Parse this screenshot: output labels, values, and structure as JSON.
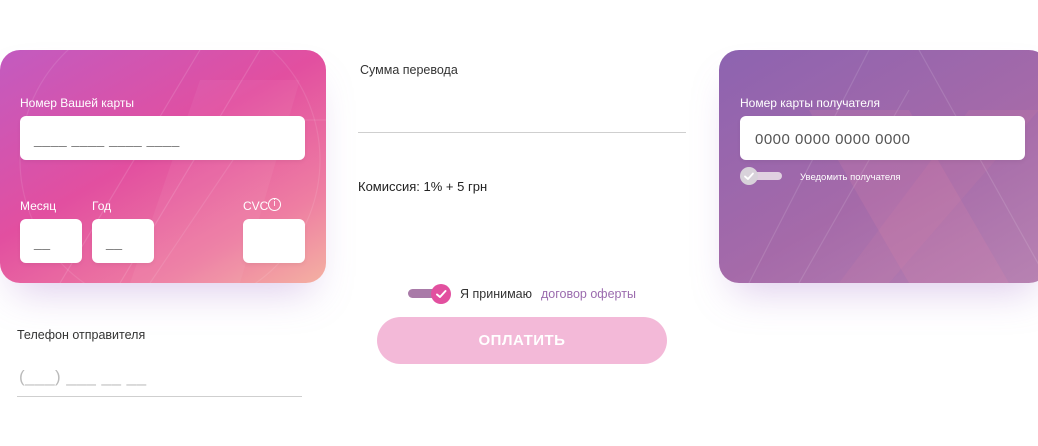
{
  "sender_card": {
    "number_label": "Номер Вашей карты",
    "number_placeholder": "____ ____ ____ ____",
    "month_label": "Месяц",
    "month_placeholder": "__",
    "year_label": "Год",
    "year_placeholder": "__",
    "cvc_label": "CVC",
    "cvc_value": ""
  },
  "transfer": {
    "amount_label": "Сумма перевода",
    "amount_value": "",
    "commission_text": "Комиссия: 1% + 5 грн"
  },
  "recipient_card": {
    "number_label": "Номер карты получателя",
    "number_placeholder": "0000 0000 0000 0000",
    "notify_label": "Уведомить получателя",
    "notify_enabled": false
  },
  "sender_phone": {
    "label": "Телефон отправителя",
    "placeholder": "(___) ___ __ __"
  },
  "agreement": {
    "accepted": true,
    "text": "Я принимаю",
    "link_text": "договор оферты"
  },
  "pay_button": {
    "label": "ОПЛАТИТЬ",
    "enabled": false
  },
  "colors": {
    "accent_pink": "#e2509f",
    "accent_purple": "#9b6bae",
    "button_disabled": "#f3b9d8"
  }
}
